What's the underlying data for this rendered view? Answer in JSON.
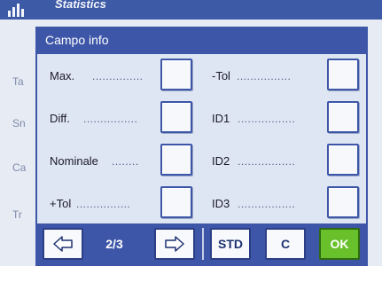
{
  "background": {
    "window_title": "Statistics",
    "side_labels": [
      "Ta",
      "Sn",
      "Ca",
      "Tr"
    ]
  },
  "dialog": {
    "title": "Campo info",
    "left_items": [
      {
        "label": "Max.",
        "dots": "..............."
      },
      {
        "label": "Diff.",
        "dots": "................"
      },
      {
        "label": "Nominale",
        "dots": "........"
      },
      {
        "label": "+Tol",
        "dots": "................"
      }
    ],
    "right_items": [
      {
        "label": "-Tol",
        "dots": "................"
      },
      {
        "label": "ID1",
        "dots": "................."
      },
      {
        "label": "ID2",
        "dots": "................."
      },
      {
        "label": "ID3",
        "dots": "................."
      }
    ]
  },
  "toolbar": {
    "page_indicator": "2/3",
    "prev_icon": "arrow-left-icon",
    "next_icon": "arrow-right-icon",
    "std_label": "STD",
    "c_label": "C",
    "ok_label": "OK"
  },
  "colors": {
    "primary": "#3d56a8",
    "panel": "#dfe6f3",
    "ok_green": "#68c12a"
  }
}
